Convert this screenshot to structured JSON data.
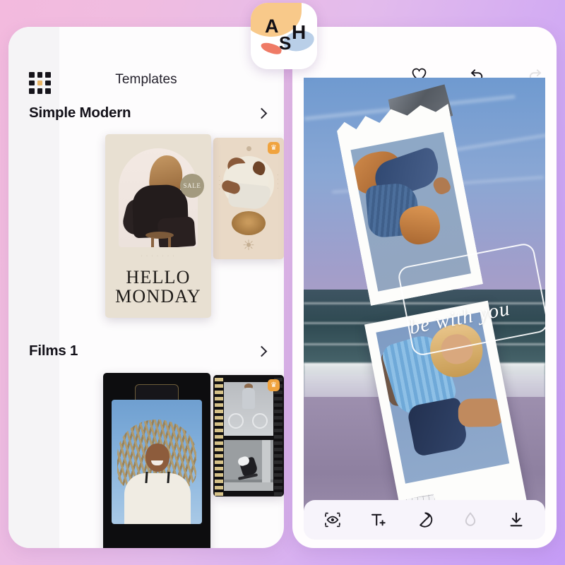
{
  "app": {
    "logo_letters": [
      "A",
      "S",
      "H"
    ],
    "logo_name": "ash-app-logo"
  },
  "theme": {
    "background_start": "#f3bade",
    "background_end": "#c59cf6",
    "panel_bg": "#fdfcfd",
    "rail_bg": "#f5f4f6",
    "accent_gold": "#e8b567",
    "crown_badge": "#f0a33e",
    "toolbar_bg": "#f7f4fb"
  },
  "left_panel": {
    "grid_icon": "grid-menu-icon",
    "title": "Templates",
    "sections": [
      {
        "title": "Simple Modern",
        "chevron": "chevron-right-icon",
        "cards": [
          {
            "name": "hello-monday-template",
            "headline_line1": "HELLO",
            "headline_line2": "MONDAY",
            "badge_text": "SALE",
            "microtext": "· · · · · · ·",
            "premium": false
          },
          {
            "name": "linen-beige-template",
            "side_text_left": "· · · ·",
            "side_text_right": "· · · ·",
            "sun_glyph": "☀",
            "premium": true,
            "premium_glyph": "♛"
          }
        ]
      },
      {
        "title": "Films 1",
        "chevron": "chevron-right-icon",
        "cards": [
          {
            "name": "black-polaroid-template",
            "premium": false
          },
          {
            "name": "film-strip-template",
            "premium": true,
            "premium_glyph": "♛"
          }
        ]
      }
    ]
  },
  "right_panel": {
    "header_actions": [
      {
        "name": "favorite-button",
        "icon": "heart-icon",
        "enabled": true
      },
      {
        "name": "undo-button",
        "icon": "undo-icon",
        "enabled": true
      },
      {
        "name": "redo-button",
        "icon": "redo-icon",
        "enabled": false
      }
    ],
    "canvas": {
      "name": "editor-canvas",
      "text_overlay": "be with you",
      "selection": "text-selection-box",
      "elements": [
        "grey-tape-sticker",
        "torn-polaroid-top",
        "polaroid-bottom",
        "grid-paper-tape"
      ]
    },
    "toolbar": [
      {
        "name": "preview-tool",
        "icon": "eye-frame-icon",
        "enabled": true
      },
      {
        "name": "add-text-tool",
        "icon": "text-plus-icon",
        "enabled": true
      },
      {
        "name": "sticker-tool",
        "icon": "sticker-peel-icon",
        "enabled": true
      },
      {
        "name": "adjust-tool",
        "icon": "water-drop-icon",
        "enabled": false
      },
      {
        "name": "download-tool",
        "icon": "download-icon",
        "enabled": true
      }
    ]
  }
}
